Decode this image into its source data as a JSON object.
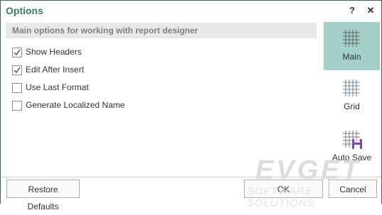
{
  "dialog": {
    "title": "Options",
    "help_label": "?",
    "close_label": "✕"
  },
  "section": {
    "header": "Main options for working with report designer"
  },
  "options": [
    {
      "label": "Show Headers",
      "checked": true
    },
    {
      "label": "Edit After Insert",
      "checked": true
    },
    {
      "label": "Use Last Format",
      "checked": false
    },
    {
      "label": "Generate Localized Name",
      "checked": false
    }
  ],
  "sidebar": {
    "items": [
      {
        "label": "Main",
        "icon": "grid-main-icon",
        "selected": true
      },
      {
        "label": "Grid",
        "icon": "grid-icon",
        "selected": false
      },
      {
        "label": "Auto Save",
        "icon": "auto-save-icon",
        "selected": false
      }
    ]
  },
  "footer": {
    "restore_label": "Restore Defaults",
    "ok_label": "OK",
    "cancel_label": "Cancel"
  },
  "watermark": {
    "brand": "EVGET",
    "tagline": "SOFTWARE SOLUTIONS"
  },
  "colors": {
    "accent": "#3a7a66",
    "selected_bg": "#a3d0c8",
    "border": "#3a6b50"
  }
}
